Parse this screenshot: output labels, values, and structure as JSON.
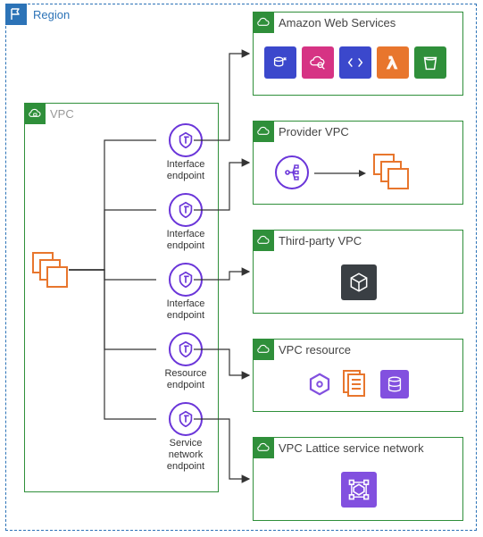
{
  "region": {
    "label": "Region"
  },
  "vpc": {
    "label": "VPC"
  },
  "endpoints": {
    "if1": "Interface\nendpoint",
    "if2": "Interface\nendpoint",
    "if3": "Interface\nendpoint",
    "res": "Resource\nendpoint",
    "svc": "Service\nnetwork\nendpoint"
  },
  "targets": {
    "aws": "Amazon Web Services",
    "provider": "Provider VPC",
    "thirdparty": "Third-party VPC",
    "resource": "VPC resource",
    "lattice": "VPC Lattice service network"
  },
  "colors": {
    "region": "#2c73b7",
    "green": "#2f8f3a",
    "purple": "#6a35d9",
    "orange": "#e8762d"
  }
}
